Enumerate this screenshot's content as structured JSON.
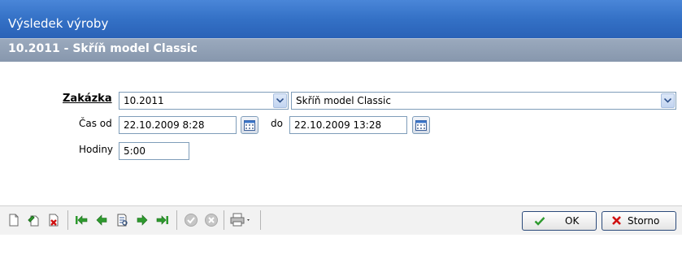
{
  "window": {
    "title": "Výsledek výroby"
  },
  "subheader": {
    "title": "10.2011  -  Skříň model Classic"
  },
  "form": {
    "zakazka_label": "Zakázka",
    "zakazka_code": "10.2011",
    "zakazka_name": "Skříň model Classic",
    "cas_od_label": "Čas od",
    "cas_od_value": "22.10.2009 8:28",
    "do_label": "do",
    "do_value": "22.10.2009 13:28",
    "hodiny_label": "Hodiny",
    "hodiny_value": "5:00"
  },
  "toolbar": {
    "icons": [
      "new-document-icon",
      "edit-document-icon",
      "delete-document-icon",
      "first-record-icon",
      "previous-record-icon",
      "detail-icon",
      "next-record-icon",
      "last-record-icon",
      "confirm-icon",
      "cancel-icon",
      "print-icon"
    ],
    "ok_label": "OK",
    "storno_label": "Storno"
  },
  "colors": {
    "title_bar": "#3471c6",
    "subheader": "#8e9db3",
    "nav_green": "#2e9a2e",
    "cancel_red": "#d01010"
  }
}
